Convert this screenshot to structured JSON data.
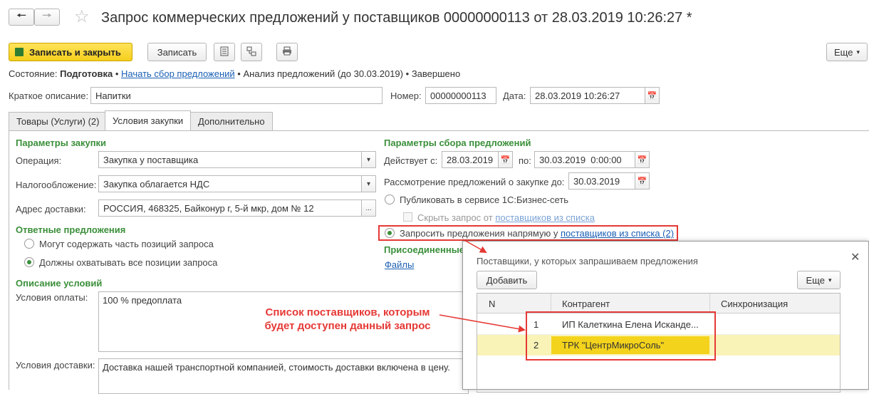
{
  "window": {
    "title": "Запрос коммерческих предложений у поставщиков 00000000113 от 28.03.2019 10:26:27 *"
  },
  "toolbar": {
    "save_close": "Записать и закрыть",
    "save": "Записать",
    "more": "Еще"
  },
  "status": {
    "label": "Состояние:",
    "current": "Подготовка",
    "sep1": "•",
    "link": "Начать сбор предложений",
    "sep2": "•",
    "analysis": "Анализ предложений (до 30.03.2019)",
    "sep3": "•",
    "done": "Завершено"
  },
  "header": {
    "short_desc_label": "Краткое описание:",
    "short_desc_value": "Напитки",
    "number_label": "Номер:",
    "number_value": "00000000113",
    "date_label": "Дата:",
    "date_value": "28.03.2019 10:26:27"
  },
  "tabs": [
    {
      "label": "Товары (Услуги) (2)"
    },
    {
      "label": "Условия закупки"
    },
    {
      "label": "Дополнительно"
    }
  ],
  "purchase": {
    "section_title": "Параметры закупки",
    "operation_label": "Операция:",
    "operation_value": "Закупка у поставщика",
    "tax_label": "Налогообложение:",
    "tax_value": "Закупка облагается НДС",
    "address_label": "Адрес доставки:",
    "address_value": "РОССИЯ, 468325, Байконур г, 5-й мкр, дом № 12"
  },
  "responses": {
    "section_title": "Ответные предложения",
    "option1": "Могут содержать часть позиций запроса",
    "option2": "Должны охватывать все позиции запроса"
  },
  "conditions": {
    "section_title": "Описание условий",
    "payment_label": "Условия оплаты:",
    "payment_value": "100 % предоплата",
    "delivery_label": "Условия доставки:",
    "delivery_value": "Доставка нашей транспортной компанией, стоимость доставки включена в цену."
  },
  "collection": {
    "section_title": "Параметры сбора предложений",
    "valid_from_label": "Действует с:",
    "valid_from_value": "28.03.2019",
    "valid_to_label": "по:",
    "valid_to_value": "30.03.2019  0:00:00",
    "review_label": "Рассмотрение предложений о закупке до:",
    "review_value": "30.03.2019",
    "publish_option": "Публиковать в сервисе 1С:Бизнес-сеть",
    "hide_request_text": "Скрыть запрос от",
    "hide_request_link": "поставщиков из списка",
    "direct_option_text": "Запросить предложения напрямую у",
    "direct_option_link": "поставщиков из списка (2)"
  },
  "attached": {
    "section_title": "Присоединенные",
    "files_link": "Файлы"
  },
  "popup": {
    "title": "Поставщики, у которых запрашиваем предложения",
    "add_button": "Добавить",
    "more_button": "Еще",
    "columns": [
      "N",
      "Контрагент",
      "Синхронизация"
    ],
    "rows": [
      {
        "n": "1",
        "name": "ИП Калеткина Елена Исканде...",
        "sync": ""
      },
      {
        "n": "2",
        "name": "ТРК \"ЦентрМикроСоль\"",
        "sync": ""
      }
    ]
  },
  "annotation": {
    "line1": "Список поставщиков, которым",
    "line2": "будет доступен данный запрос",
    "color": "#e53935"
  }
}
